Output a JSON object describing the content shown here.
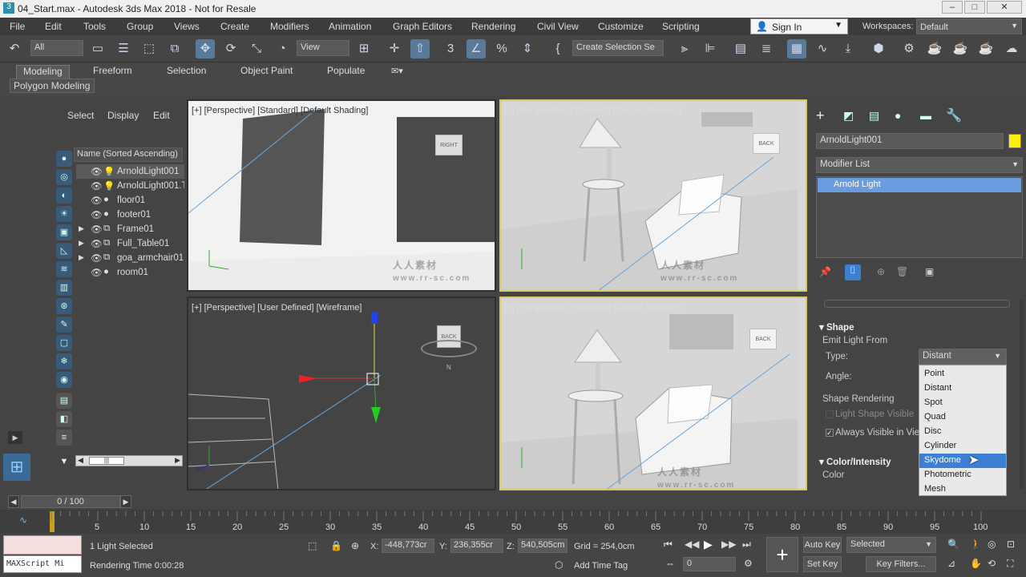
{
  "title": {
    "text": "04_Start.max - Autodesk 3ds Max 2018 - Not for Resale"
  },
  "menu": [
    "File",
    "Edit",
    "Tools",
    "Group",
    "Views",
    "Create",
    "Modifiers",
    "Animation",
    "Graph Editors",
    "Rendering",
    "Civil View",
    "Customize",
    "Scripting"
  ],
  "sign_in": "Sign In",
  "workspaces": {
    "label": "Workspaces:",
    "value": "Default"
  },
  "toolbar": {
    "filter": "All",
    "view": "View",
    "selection_set": "Create Selection Se"
  },
  "ribbon": {
    "tabs": [
      "Modeling",
      "Freeform",
      "Selection",
      "Object Paint",
      "Populate"
    ],
    "sub": "Polygon Modeling"
  },
  "scene": {
    "tabs": [
      "Select",
      "Display",
      "Edit"
    ],
    "header": "Name (Sorted Ascending)",
    "items": [
      "ArnoldLight001",
      "ArnoldLight001.T",
      "floor01",
      "footer01",
      "Frame01",
      "Full_Table01",
      "goa_armchair01",
      "room01"
    ]
  },
  "viewports": {
    "tl": "[+] [Perspective] [Standard] [Default Shading]",
    "tr": "[+] [Perspective] [Standard] [Default Shading]",
    "bl": "[+] [Perspective] [User Defined] [Wireframe]",
    "br": "[+] [Perspective] [Standard] [Default Shading]"
  },
  "cube_labels": {
    "right": "RIGHT",
    "back": "BACK",
    "north": "N"
  },
  "command": {
    "object_name": "ArnoldLight001",
    "modifier_list": "Modifier List",
    "stack_item": "Arnold Light",
    "shape_section": "Shape",
    "emit_from": "Emit Light From",
    "type_label": "Type:",
    "type_value": "Distant",
    "angle_label": "Angle:",
    "shape_rendering": "Shape Rendering",
    "light_shape_visible": "Light Shape Visible",
    "always_visible": "Always Visible in View",
    "color_section": "Color/Intensity",
    "color_label": "Color",
    "type_options": [
      "Point",
      "Distant",
      "Spot",
      "Quad",
      "Disc",
      "Cylinder",
      "Skydome",
      "Photometric",
      "Mesh"
    ]
  },
  "timeline": {
    "frame": "0 / 100",
    "ticks": [
      "0",
      "5",
      "10",
      "15",
      "20",
      "25",
      "30",
      "35",
      "40",
      "45",
      "50",
      "55",
      "60",
      "65",
      "70",
      "75",
      "80",
      "85",
      "90",
      "95",
      "100"
    ]
  },
  "status": {
    "maxscript": "MAXScript Mi",
    "selection": "1 Light Selected",
    "render_time": "Rendering Time  0:00:28",
    "x_label": "X:",
    "x_value": "-448,773cr",
    "y_label": "Y:",
    "y_value": "236,355cr",
    "z_label": "Z:",
    "z_value": "540,505cm",
    "grid": "Grid = 254,0cm",
    "add_time_tag": "Add Time Tag",
    "auto_key": "Auto Key",
    "set_key": "Set Key",
    "selected": "Selected",
    "key_filters": "Key Filters...",
    "frame_field": "0"
  },
  "watermark": {
    "cn": "人人素材",
    "url": "www.rr-sc.com"
  },
  "colors": {
    "accent": "#3d7fd3",
    "active_border": "#d8c86a",
    "object_swatch": "#ffef00"
  }
}
